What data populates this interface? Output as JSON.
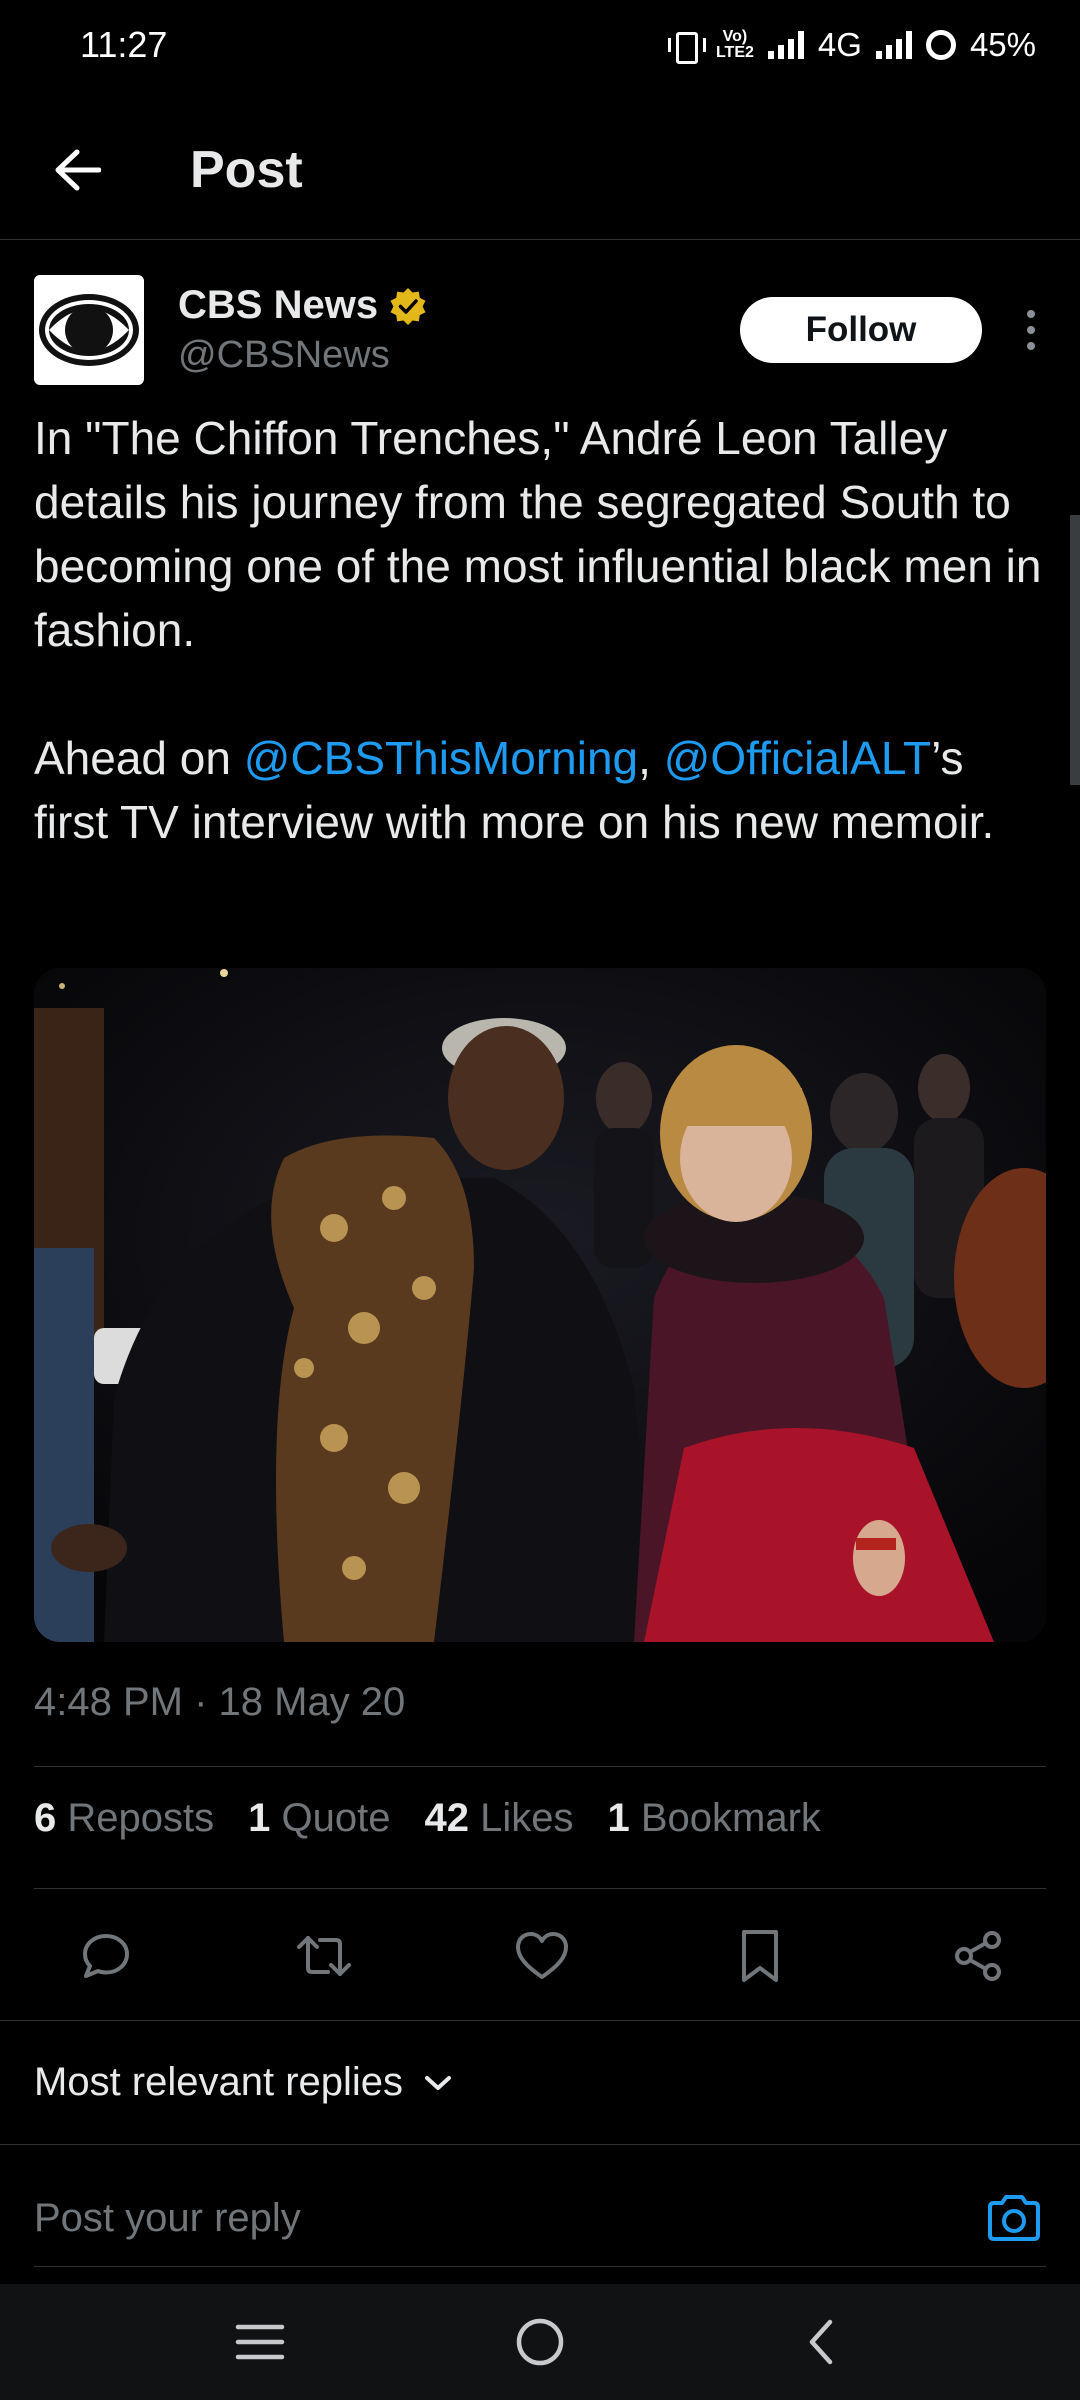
{
  "status_bar": {
    "time": "11:27",
    "volte_top": "Vo)",
    "volte_bottom": "LTE2",
    "network": "4G",
    "battery": "45%"
  },
  "header": {
    "title": "Post"
  },
  "author": {
    "display_name": "CBS News",
    "handle": "@CBSNews",
    "verified_color": "#e2b719",
    "follow_label": "Follow"
  },
  "tweet": {
    "para1": "In \"The Chiffon Trenches,\" André Leon Talley details his journey from the segregated South to becoming one of the most influential black men in fashion.",
    "para2_prefix": "Ahead on ",
    "mention1": "@CBSThisMorning",
    "separator": ", ",
    "mention2": "@OfficialALT",
    "para2_suffix": "’s first TV interview with more on his new memoir.",
    "mention_color": "#1d9bf0"
  },
  "timestamp": "4:48 PM · 18 May 20",
  "stats": {
    "reposts_count": "6",
    "reposts_label": "Reposts",
    "quotes_count": "1",
    "quotes_label": "Quote",
    "likes_count": "42",
    "likes_label": "Likes",
    "bookmarks_count": "1",
    "bookmarks_label": "Bookmark"
  },
  "actions": [
    "reply-icon",
    "repost-icon",
    "like-icon",
    "bookmark-icon",
    "share-icon"
  ],
  "replies": {
    "filter_label": "Most relevant replies"
  },
  "reply_box": {
    "placeholder": "Post your reply"
  },
  "navbar": [
    "menu-icon",
    "home-icon",
    "back-icon"
  ]
}
